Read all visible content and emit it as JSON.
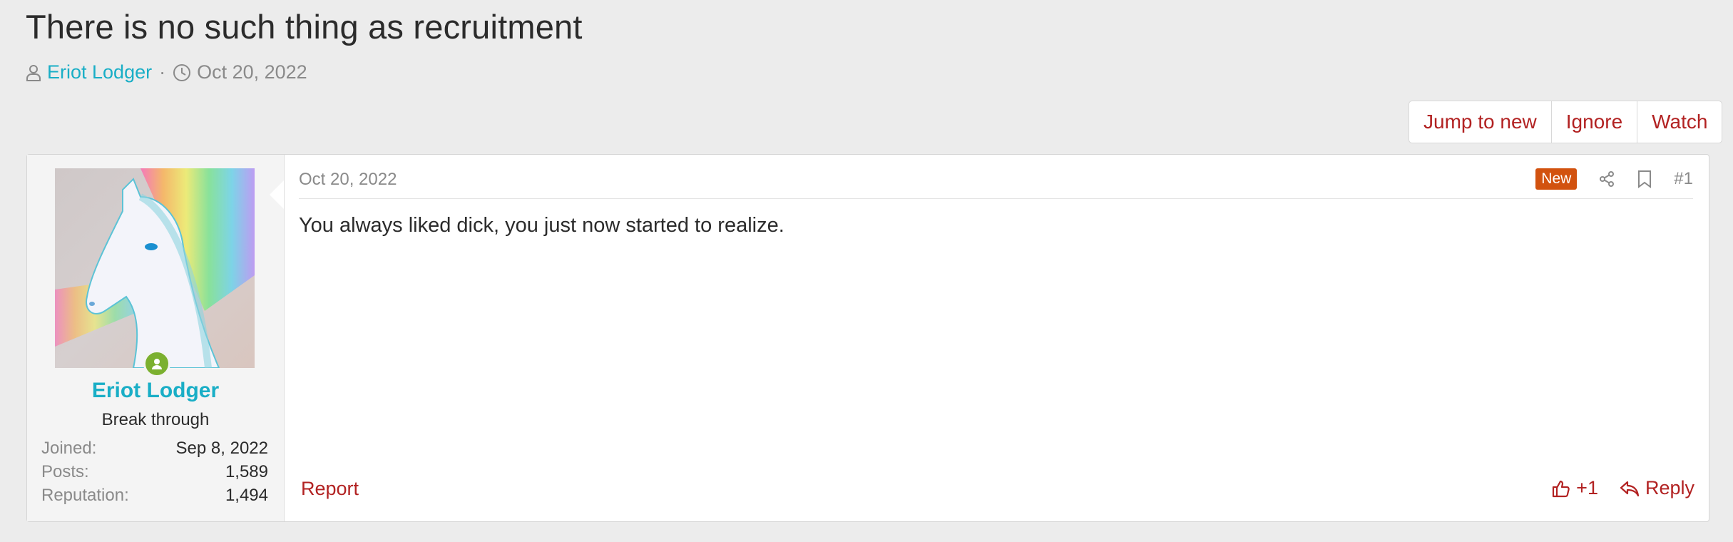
{
  "thread": {
    "title": "There is no such thing as recruitment",
    "author": "Eriot Lodger",
    "separator": "·",
    "date": "Oct 20, 2022"
  },
  "thread_actions": {
    "jump_to_new": "Jump to new",
    "ignore": "Ignore",
    "watch": "Watch"
  },
  "post": {
    "user": {
      "name": "Eriot Lodger",
      "title": "Break through",
      "stats": [
        {
          "label": "Joined:",
          "value": "Sep 8, 2022"
        },
        {
          "label": "Posts:",
          "value": "1,589"
        },
        {
          "label": "Reputation:",
          "value": "1,494"
        }
      ]
    },
    "date": "Oct 20, 2022",
    "badge": "New",
    "number": "#1",
    "body": "You always liked dick, you just now started to realize.",
    "report": "Report",
    "like_count": "+1",
    "reply": "Reply"
  },
  "icons": {
    "author": "user-icon",
    "date": "clock-icon",
    "share": "share-icon",
    "bookmark": "bookmark-icon",
    "like": "thumbs-up-icon",
    "reply": "reply-icon",
    "online": "online-status-icon"
  },
  "colors": {
    "link": "#19aec6",
    "action": "#b22222",
    "new_badge": "#d2520f",
    "online": "#7bb02f",
    "background": "#ececec"
  }
}
